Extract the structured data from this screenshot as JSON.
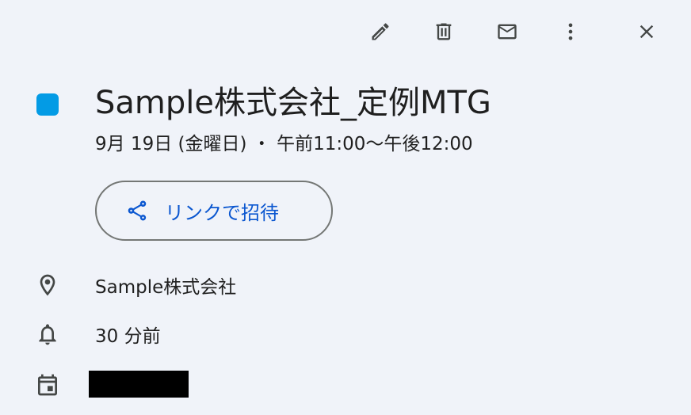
{
  "toolbar": {
    "edit": "edit-icon",
    "delete": "delete-icon",
    "email": "email-icon",
    "more": "more-vert-icon",
    "close": "close-icon"
  },
  "event": {
    "color": "#039be5",
    "title": "Sample株式会社_定例MTG",
    "datetime": "9月 19日 (金曜日)  ・  午前11:00〜午後12:00"
  },
  "invite": {
    "label": "リンクで招待"
  },
  "details": {
    "location": "Sample株式会社",
    "reminder": "30 分前",
    "calendar": ""
  }
}
